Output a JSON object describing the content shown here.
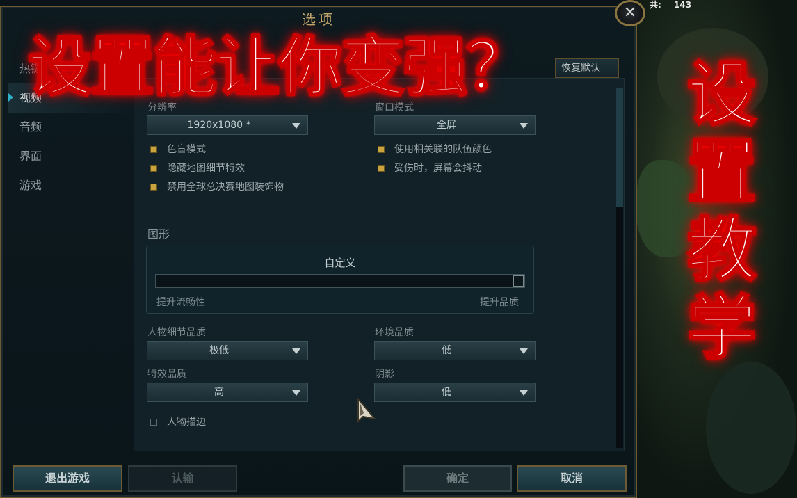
{
  "hud": {
    "counter_label": "共:",
    "counter_value": "143"
  },
  "window": {
    "title": "选项",
    "close_symbol": "✕"
  },
  "sidebar": {
    "items": [
      {
        "label": "热键",
        "active": false
      },
      {
        "label": "视频",
        "active": true
      },
      {
        "label": "音频",
        "active": false
      },
      {
        "label": "界面",
        "active": false
      },
      {
        "label": "游戏",
        "active": false
      }
    ]
  },
  "header": {
    "restore_default": "恢复默认"
  },
  "video": {
    "resolution_label": "分辨率",
    "resolution_value": "1920x1080 *",
    "window_mode_label": "窗口模式",
    "window_mode_value": "全屏",
    "checkboxes_left": [
      {
        "label": "色盲模式",
        "checked": true
      },
      {
        "label": "隐藏地图细节特效",
        "checked": true
      },
      {
        "label": "禁用全球总决赛地图装饰物",
        "checked": true
      }
    ],
    "checkboxes_right": [
      {
        "label": "使用相关联的队伍颜色",
        "checked": true
      },
      {
        "label": "受伤时，屏幕会抖动",
        "checked": true
      }
    ]
  },
  "graphics": {
    "section_label": "图形",
    "preset_label": "自定义",
    "slider_level": 1.0,
    "slider_left_label": "提升流畅性",
    "slider_right_label": "提升品质",
    "character_quality_label": "人物细节品质",
    "character_quality_value": "极低",
    "environment_quality_label": "环境品质",
    "environment_quality_value": "低",
    "effects_quality_label": "特效品质",
    "effects_quality_value": "高",
    "shadows_label": "阴影",
    "shadows_value": "低",
    "character_outline_label": "人物描边",
    "character_outline_checked": false
  },
  "footer": {
    "exit_game": "退出游戏",
    "surrender": "认输",
    "confirm": "确定",
    "cancel": "取消"
  },
  "overlay": {
    "title": "设置能让你变强？",
    "side_caption": "设置教学"
  },
  "colors": {
    "accent_gold": "#c8aa6e",
    "checkbox_gold": "#c9a43e",
    "overlay_glow": "#ff0000"
  }
}
